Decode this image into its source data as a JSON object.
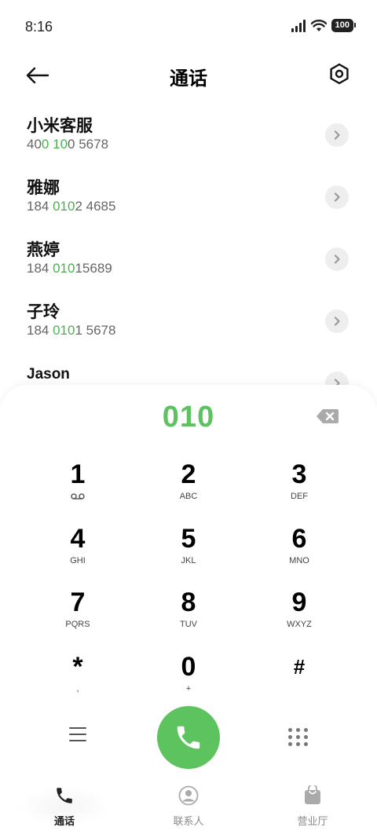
{
  "status_bar": {
    "time": "8:16",
    "battery": "100"
  },
  "header": {
    "title": "通话"
  },
  "contacts": [
    {
      "name": "小米客服",
      "number_parts": [
        "40",
        "0",
        " ",
        "10",
        "0 5678"
      ]
    },
    {
      "name": "雅娜",
      "number_parts": [
        "184 ",
        "010",
        "2 4685"
      ]
    },
    {
      "name": "燕婷",
      "number_parts": [
        "184 ",
        "010",
        "15689"
      ]
    },
    {
      "name": "子玲",
      "number_parts": [
        "184 ",
        "010",
        "1 5678"
      ]
    },
    {
      "name": "Jason"
    }
  ],
  "dialpad": {
    "display": "010",
    "accent_color": "#5cc35f",
    "keys": [
      {
        "digit": "1",
        "letters": ""
      },
      {
        "digit": "2",
        "letters": "ABC"
      },
      {
        "digit": "3",
        "letters": "DEF"
      },
      {
        "digit": "4",
        "letters": "GHI"
      },
      {
        "digit": "5",
        "letters": "JKL"
      },
      {
        "digit": "6",
        "letters": "MNO"
      },
      {
        "digit": "7",
        "letters": "PQRS"
      },
      {
        "digit": "8",
        "letters": "TUV"
      },
      {
        "digit": "9",
        "letters": "WXYZ"
      },
      {
        "digit": "*",
        "letters": ","
      },
      {
        "digit": "0",
        "letters": "+"
      },
      {
        "digit": "#",
        "letters": ""
      }
    ]
  },
  "bottom_nav": {
    "items": [
      {
        "label": "通话",
        "icon": "phone-icon",
        "active": true
      },
      {
        "label": "联系人",
        "icon": "person-icon",
        "active": false
      },
      {
        "label": "营业厅",
        "icon": "shopping-bag-icon",
        "active": false
      }
    ]
  }
}
